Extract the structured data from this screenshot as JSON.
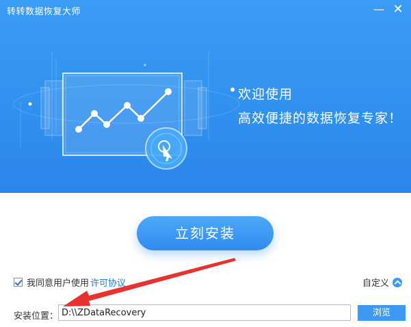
{
  "window": {
    "title": "转转数据恢复大师",
    "minimize_label": "—",
    "close_label": "✕"
  },
  "banner": {
    "welcome": "欢迎使用",
    "slogan": "高效便捷的数据恢复专家！",
    "illustration_icons": [
      "line-chart-icon",
      "cursor-click-icon"
    ]
  },
  "install": {
    "button_label": "立刻安装"
  },
  "agreement": {
    "checked": true,
    "text": "我同意用户使用",
    "link_label": "许可协议"
  },
  "custom": {
    "label": "自定义"
  },
  "install_path": {
    "label": "安装位置：",
    "value": "D:\\\\ZDataRecovery",
    "browse_label": "浏览"
  },
  "colors": {
    "banner": "#3191ef",
    "accent": "#3d9af2",
    "link": "#1c7ae6",
    "arrow": "#e8322f"
  }
}
